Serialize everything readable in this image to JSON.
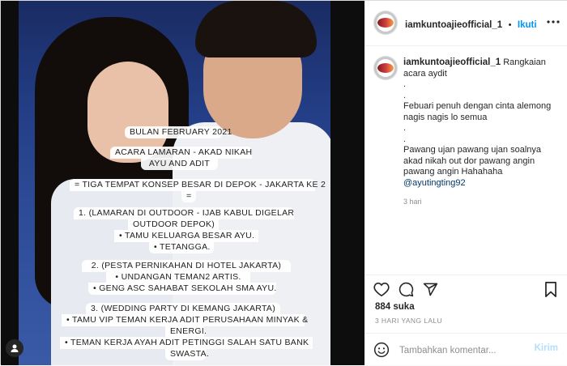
{
  "post": {
    "card_lines": [
      "BULAN FEBRUARY 2021",
      "ACARA LAMARAN - AKAD NIKAH",
      "AYU AND ADIT",
      "= TIGA TEMPAT KONSEP BESAR DI DEPOK - JAKARTA KE 2",
      "=",
      "1. (LAMARAN DI OUTDOOR - IJAB KABUL DIGELAR",
      "OUTDOOR DEPOK)",
      "• TAMU KELUARGA BESAR AYU.",
      "• TETANGGA.",
      "2. (PESTA PERNIKAHAN DI HOTEL JAKARTA)",
      "• UNDANGAN TEMAN2 ARTIS.",
      "• GENG ASC SAHABAT SEKOLAH SMA AYU.",
      "3. (WEDDING PARTY DI KEMANG JAKARTA)",
      "• TAMU VIP TEMAN KERJA ADIT PERUSAHAAN MINYAK &",
      "ENERGI.",
      "• TEMAN KERJA AYAH ADIT PETINGGI SALAH SATU BANK",
      "SWASTA."
    ]
  },
  "header": {
    "username": "iamkuntoajieofficial_1",
    "separator": "•",
    "follow_label": "Ikuti",
    "more_icon": "more-horizontal-icon"
  },
  "caption": {
    "username": "iamkuntoajieofficial_1",
    "text_1": " Rangkaian acara aydit",
    "text_2": ".\n.\nFebuari penuh dengan cinta alemong nagis nagis lo semua",
    "text_3": ".\n.\nPawang ujan pawang ujan soalnya akad nikah out dor pawang angin pawang angin Hahahaha",
    "mention": "@ayutingting92",
    "time": "3 hari"
  },
  "actions": {
    "like_icon": "heart-icon",
    "comment_icon": "comment-icon",
    "share_icon": "share-icon",
    "save_icon": "bookmark-icon",
    "likes": "884 suka",
    "ago": "3 HARI YANG LALU"
  },
  "comment_box": {
    "emoji_icon": "emoji-icon",
    "placeholder": "Tambahkan komentar...",
    "post_label": "Kirim"
  },
  "colors": {
    "accent": "#0095f6",
    "post_disabled": "#b2dffc",
    "muted": "#8e8e8e",
    "text": "#262626"
  }
}
